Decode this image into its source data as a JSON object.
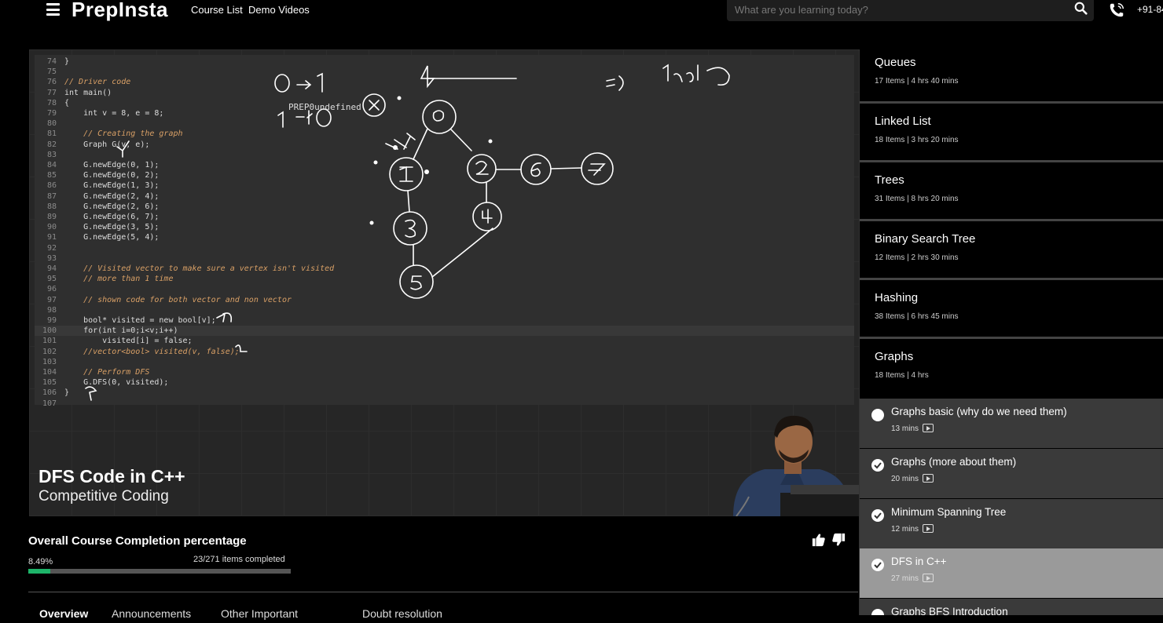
{
  "header": {
    "logo": "PrepInsta",
    "nav": [
      "Course List",
      "Demo Videos"
    ],
    "search_placeholder": "What are you learning today?",
    "phone": "+91-84"
  },
  "video": {
    "overlay_text": "PREP0undefined",
    "title": "DFS Code in C++",
    "subtitle": "Competitive Coding",
    "code_lines": [
      {
        "n": "74",
        "t": "}",
        "cls": "code"
      },
      {
        "n": "75",
        "t": "",
        "cls": "code"
      },
      {
        "n": "76",
        "t": "// Driver code",
        "cls": "comment"
      },
      {
        "n": "77",
        "t": "int main()",
        "cls": "code"
      },
      {
        "n": "78",
        "t": "{",
        "cls": "code"
      },
      {
        "n": "79",
        "t": "    int v = 8, e = 8;",
        "cls": "code"
      },
      {
        "n": "80",
        "t": "",
        "cls": "code"
      },
      {
        "n": "81",
        "t": "    // Creating the graph",
        "cls": "comment"
      },
      {
        "n": "82",
        "t": "    Graph G(v, e);",
        "cls": "code"
      },
      {
        "n": "83",
        "t": "",
        "cls": "code"
      },
      {
        "n": "84",
        "t": "    G.newEdge(0, 1);",
        "cls": "code"
      },
      {
        "n": "85",
        "t": "    G.newEdge(0, 2);",
        "cls": "code"
      },
      {
        "n": "86",
        "t": "    G.newEdge(1, 3);",
        "cls": "code"
      },
      {
        "n": "87",
        "t": "    G.newEdge(2, 4);",
        "cls": "code"
      },
      {
        "n": "88",
        "t": "    G.newEdge(2, 6);",
        "cls": "code"
      },
      {
        "n": "89",
        "t": "    G.newEdge(6, 7);",
        "cls": "code"
      },
      {
        "n": "90",
        "t": "    G.newEdge(3, 5);",
        "cls": "code"
      },
      {
        "n": "91",
        "t": "    G.newEdge(5, 4);",
        "cls": "code"
      },
      {
        "n": "92",
        "t": "",
        "cls": "code"
      },
      {
        "n": "93",
        "t": "",
        "cls": "code"
      },
      {
        "n": "94",
        "t": "    // Visited vector to make sure a vertex isn't visited",
        "cls": "comment"
      },
      {
        "n": "95",
        "t": "    // more than 1 time",
        "cls": "comment"
      },
      {
        "n": "96",
        "t": "",
        "cls": "code"
      },
      {
        "n": "97",
        "t": "    // shown code for both vector and non vector",
        "cls": "comment"
      },
      {
        "n": "98",
        "t": "",
        "cls": "code"
      },
      {
        "n": "99",
        "t": "    bool* visited = new bool[v];",
        "cls": "code"
      },
      {
        "n": "100",
        "t": "    for(int i=0;i<v;i++)",
        "cls": "kw"
      },
      {
        "n": "101",
        "t": "        visited[i] = false;",
        "cls": "code"
      },
      {
        "n": "102",
        "t": "    //vector<bool> visited(v, false);",
        "cls": "comment"
      },
      {
        "n": "103",
        "t": "",
        "cls": "code"
      },
      {
        "n": "104",
        "t": "    // Perform DFS",
        "cls": "comment"
      },
      {
        "n": "105",
        "t": "    G.DFS(0, visited);",
        "cls": "code"
      },
      {
        "n": "106",
        "t": "}",
        "cls": "code"
      },
      {
        "n": "107",
        "t": "",
        "cls": "code"
      }
    ]
  },
  "progress": {
    "title": "Overall Course Completion percentage",
    "percent_label": "8.49%",
    "percent_value": 8.49,
    "count_label": "23/271 items completed",
    "accent": "#1db469"
  },
  "bottom_tabs": [
    "Overview",
    "Announcements",
    "Other Important",
    "Doubt resolution"
  ],
  "sidebar": {
    "sections": [
      {
        "title": "Queues",
        "meta": "17 Items | 4 hrs 40 mins"
      },
      {
        "title": "Linked List",
        "meta": "18 Items | 3 hrs 20 mins"
      },
      {
        "title": "Trees",
        "meta": "31 Items | 8 hrs 20 mins"
      },
      {
        "title": "Binary Search Tree",
        "meta": "12 Items | 2 hrs 30 mins"
      },
      {
        "title": "Hashing",
        "meta": "38 Items | 6 hrs 45 mins"
      },
      {
        "title": "Graphs",
        "meta": "18 Items | 4 hrs"
      }
    ],
    "lessons": [
      {
        "title": "Graphs basic (why do we need them)",
        "duration": "13 mins",
        "completed": false,
        "active": false
      },
      {
        "title": "Graphs (more about them)",
        "duration": "20 mins",
        "completed": true,
        "active": false
      },
      {
        "title": "Minimum Spanning Tree",
        "duration": "12 mins",
        "completed": true,
        "active": false
      },
      {
        "title": "DFS in C++",
        "duration": "27 mins",
        "completed": true,
        "active": true
      },
      {
        "title": "Graphs BFS Introduction",
        "duration": "",
        "completed": false,
        "active": false
      }
    ]
  }
}
